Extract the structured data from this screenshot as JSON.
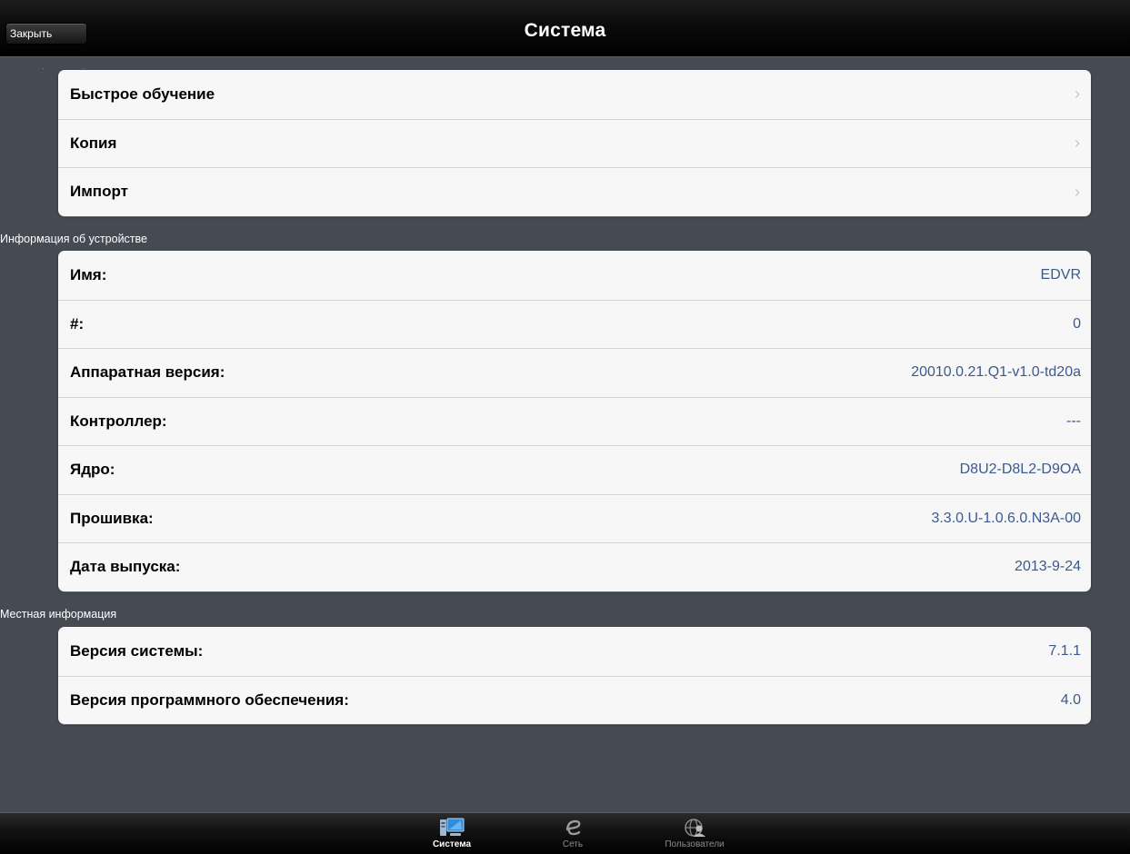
{
  "nav": {
    "title": "Система",
    "close_label": "Закрыть"
  },
  "menu": {
    "items": [
      {
        "label": "Быстрое обучение"
      },
      {
        "label": "Копия"
      },
      {
        "label": "Импорт"
      }
    ]
  },
  "device_info": {
    "header": "Информация об устройстве",
    "rows": [
      {
        "label": "Имя:",
        "value": "EDVR"
      },
      {
        "label": "#:",
        "value": "0"
      },
      {
        "label": "Аппаратная версия:",
        "value": "20010.0.21.Q1-v1.0-td20a"
      },
      {
        "label": "Контроллер:",
        "value": "---"
      },
      {
        "label": "Ядро:",
        "value": "D8U2-D8L2-D9OA"
      },
      {
        "label": "Прошивка:",
        "value": "3.3.0.U-1.0.6.0.N3A-00"
      },
      {
        "label": "Дата выпуска:",
        "value": "2013-9-24"
      }
    ]
  },
  "local_info": {
    "header": "Местная информация",
    "rows": [
      {
        "label": "Версия системы:",
        "value": "7.1.1"
      },
      {
        "label": "Версия программного обеспечения:",
        "value": "4.0"
      }
    ]
  },
  "tabbar": {
    "tabs": [
      {
        "label": "Система",
        "icon": "monitor-icon",
        "active": true
      },
      {
        "label": "Сеть",
        "icon": "network-e-icon",
        "active": false
      },
      {
        "label": "Пользователи",
        "icon": "users-globe-icon",
        "active": false
      }
    ]
  },
  "colors": {
    "background": "#454a53",
    "value_text": "#3d5a8c",
    "active_tab_icon": "#2a8ee0"
  }
}
